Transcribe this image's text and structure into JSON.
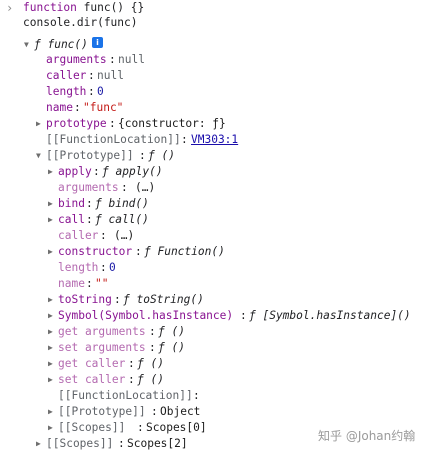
{
  "input": {
    "line1": "function func() {}",
    "line2": "console.dir(func)"
  },
  "obj": {
    "header": "ƒ func()",
    "info": "i",
    "arguments_key": "arguments",
    "arguments_val": "null",
    "caller_key": "caller",
    "caller_val": "null",
    "length_key": "length",
    "length_val": "0",
    "name_key": "name",
    "name_val": "\"func\"",
    "prototype_key": "prototype",
    "prototype_val": "{constructor: ƒ}",
    "funcloc_key": "[[FunctionLocation]]",
    "funcloc_val": "VM303:1",
    "protoslot_key": "[[Prototype]]",
    "protoslot_val": "ƒ ()"
  },
  "proto": {
    "apply_key": "apply",
    "apply_val": "ƒ apply()",
    "arguments_key": "arguments",
    "arguments_val": "(…)",
    "bind_key": "bind",
    "bind_val": "ƒ bind()",
    "call_key": "call",
    "call_val": "ƒ call()",
    "caller_key": "caller",
    "caller_val": "(…)",
    "constructor_key": "constructor",
    "constructor_val": "ƒ Function()",
    "length_key": "length",
    "length_val": "0",
    "name_key": "name",
    "name_val": "\"\"",
    "tostring_key": "toString",
    "tostring_val": "ƒ toString()",
    "hasinstance_key": "Symbol(Symbol.hasInstance)",
    "hasinstance_val": "ƒ [Symbol.hasInstance]()",
    "get_arguments_key": "get arguments",
    "get_arguments_val": "ƒ ()",
    "set_arguments_key": "set arguments",
    "set_arguments_val": "ƒ ()",
    "get_caller_key": "get caller",
    "get_caller_val": "ƒ ()",
    "set_caller_key": "set caller",
    "set_caller_val": "ƒ ()",
    "funcloc_key": "[[FunctionLocation]]",
    "protoslot_key": "[[Prototype]]",
    "protoslot_val": "Object",
    "scopes_key": "[[Scopes]]",
    "scopes_val": "Scopes[0]"
  },
  "outer_scopes": {
    "key": "[[Scopes]]",
    "val": "Scopes[2]"
  },
  "watermark": "知乎 @Johan约翰"
}
